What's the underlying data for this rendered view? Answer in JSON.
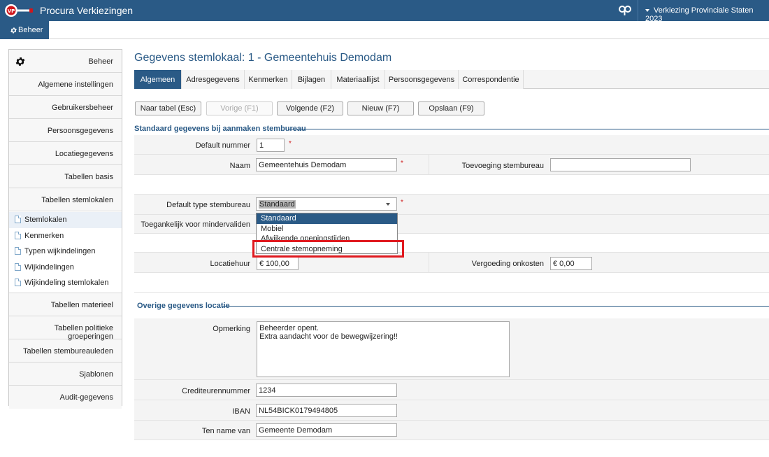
{
  "app": {
    "title": "Procura Verkiezingen",
    "election": "Verkiezing Provinciale Staten 2023"
  },
  "subbar": {
    "beheer_label": "Beheer"
  },
  "sidebar": {
    "header": "Beheer",
    "items_top": [
      "Algemene instellingen",
      "Gebruikersbeheer",
      "Persoonsgegevens",
      "Locatiegegevens",
      "Tabellen basis",
      "Tabellen stemlokalen"
    ],
    "sub_items": [
      "Stemlokalen",
      "Kenmerken",
      "Typen wijkindelingen",
      "Wijkindelingen",
      "Wijkindeling stemlokalen"
    ],
    "items_bottom": [
      "Tabellen materieel",
      "Tabellen politieke groeperingen",
      "Tabellen stembureauleden",
      "Sjablonen",
      "Audit-gegevens"
    ]
  },
  "main": {
    "title": "Gegevens stemlokaal: 1 - Gemeentehuis Demodam",
    "tabs": [
      "Algemeen",
      "Adresgegevens",
      "Kenmerken",
      "Bijlagen",
      "Materiaallijst",
      "Persoonsgegevens",
      "Correspondentie"
    ],
    "buttons": {
      "back": "Naar tabel (Esc)",
      "prev": "Vorige (F1)",
      "next": "Volgende (F2)",
      "new": "Nieuw (F7)",
      "save": "Opslaan (F9)"
    }
  },
  "form": {
    "section1": "Standaard gegevens bij aanmaken stembureau",
    "default_nummer_label": "Default nummer",
    "default_nummer_value": "1",
    "naam_label": "Naam",
    "naam_value": "Gemeentehuis Demodam",
    "toevoeging_label": "Toevoeging stembureau",
    "toevoeging_value": "",
    "type_label": "Default type stembureau",
    "type_value": "Standaard",
    "toegankelijk_label": "Toegankelijk voor mindervaliden",
    "dropdown_options": [
      "Standaard",
      "Mobiel",
      "Afwijkende openingstijden",
      "Centrale stemopneming"
    ],
    "locatiehuur_label": "Locatiehuur",
    "locatiehuur_value": "€ 100,00",
    "vergoeding_label": "Vergoeding onkosten",
    "vergoeding_value": "€ 0,00",
    "required_mark": "*",
    "section2": "Overige gegevens locatie",
    "opmerking_label": "Opmerking",
    "opmerking_value": "Beheerder opent.\nExtra aandacht voor de bewegwijzering!!",
    "crediteur_label": "Crediteurennummer",
    "crediteur_value": "1234",
    "iban_label": "IBAN",
    "iban_value": "NL54BICK0179494805",
    "tennamevan_label": "Ten name van",
    "tennamevan_value": "Gemeente Demodam"
  },
  "colors": {
    "primary": "#2a5a86",
    "highlight": "#e0191f",
    "required": "#d02020"
  }
}
